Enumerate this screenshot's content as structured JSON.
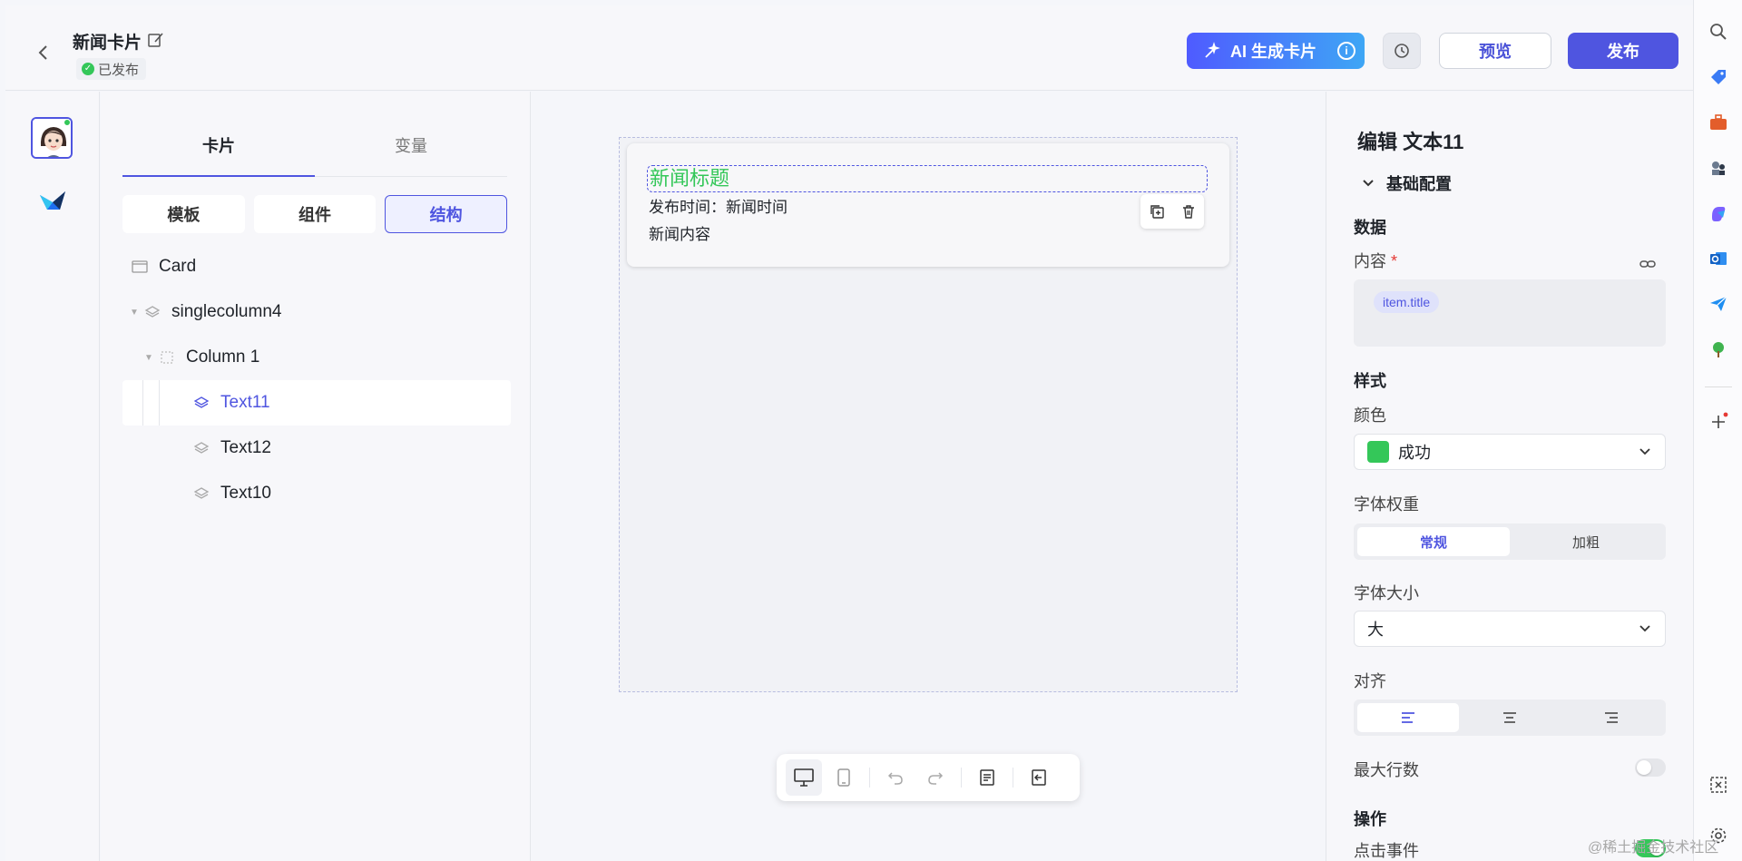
{
  "header": {
    "title": "新闻卡片",
    "status": "已发布",
    "ai_button": "AI 生成卡片",
    "preview_button": "预览",
    "publish_button": "发布"
  },
  "tree_panel": {
    "tabs": [
      {
        "label": "卡片",
        "active": true
      },
      {
        "label": "变量",
        "active": false
      }
    ],
    "segments": [
      {
        "label": "模板",
        "active": false
      },
      {
        "label": "组件",
        "active": false
      },
      {
        "label": "结构",
        "active": true
      }
    ],
    "nodes": [
      {
        "label": "Card",
        "depth": 0,
        "icon": "card-icon",
        "selected": false
      },
      {
        "label": "singlecolumn4",
        "depth": 0,
        "icon": "layers-icon",
        "selected": false,
        "expandable": true
      },
      {
        "label": "Column 1",
        "depth": 1,
        "icon": "column-icon",
        "selected": false,
        "expandable": true
      },
      {
        "label": "Text11",
        "depth": 2,
        "icon": "layers-icon",
        "selected": true
      },
      {
        "label": "Text12",
        "depth": 2,
        "icon": "layers-icon",
        "selected": false
      },
      {
        "label": "Text10",
        "depth": 2,
        "icon": "layers-icon",
        "selected": false
      }
    ]
  },
  "canvas": {
    "card_title": "新闻标题",
    "card_time": "发布时间：新闻时间",
    "card_content": "新闻内容"
  },
  "props": {
    "title": "编辑 文本11",
    "section": "基础配置",
    "data_heading": "数据",
    "content_label": "内容",
    "required_mark": "*",
    "content_chip": "item.title",
    "style_heading": "样式",
    "color_label": "颜色",
    "color_value": "成功",
    "weight_label": "字体权重",
    "weight_options": [
      {
        "label": "常规",
        "active": true
      },
      {
        "label": "加粗",
        "active": false
      }
    ],
    "size_label": "字体大小",
    "size_value": "大",
    "align_label": "对齐",
    "align_options": [
      {
        "name": "align-left-icon",
        "active": true
      },
      {
        "name": "align-center-icon",
        "active": false
      },
      {
        "name": "align-right-icon",
        "active": false
      }
    ],
    "max_lines_label": "最大行数",
    "max_lines_enabled": false,
    "action_heading": "操作",
    "click_event_label": "点击事件",
    "click_event_enabled": true
  },
  "colors": {
    "accent": "#4f55e0",
    "success": "#34c759"
  },
  "watermark": "@稀土掘金技术社区"
}
